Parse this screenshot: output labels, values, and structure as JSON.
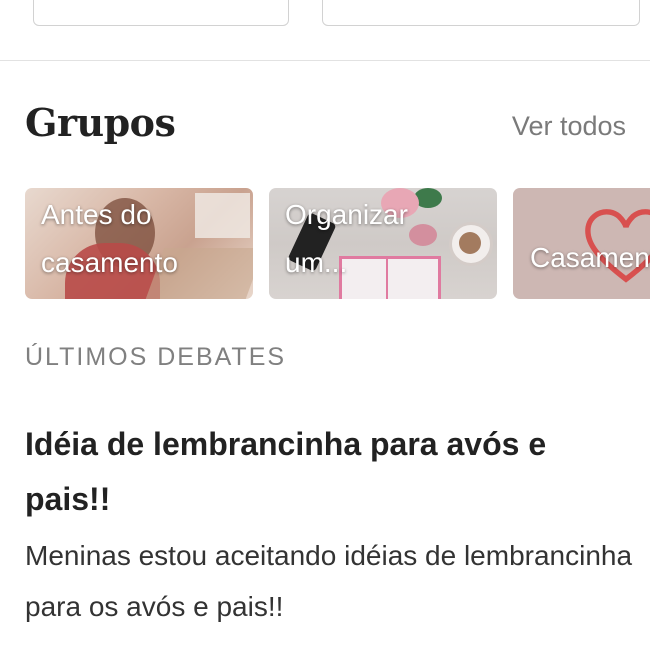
{
  "groups": {
    "title": "Grupos",
    "see_all": "Ver todos",
    "cards": [
      {
        "label": "Antes do\ncasamento"
      },
      {
        "label": "Organizar\num..."
      },
      {
        "label": "Casamento"
      }
    ]
  },
  "latest_debates": {
    "heading": "ÚLTIMOS DEBATES",
    "items": [
      {
        "title": "Idéia de lembrancinha para avós e pais!!",
        "excerpt": "Meninas estou aceitando idéias de lembrancinha para os avós e pais!!"
      }
    ]
  },
  "colors": {
    "accent_heart": "#d8504f",
    "muted_text": "#7a7a7a"
  }
}
